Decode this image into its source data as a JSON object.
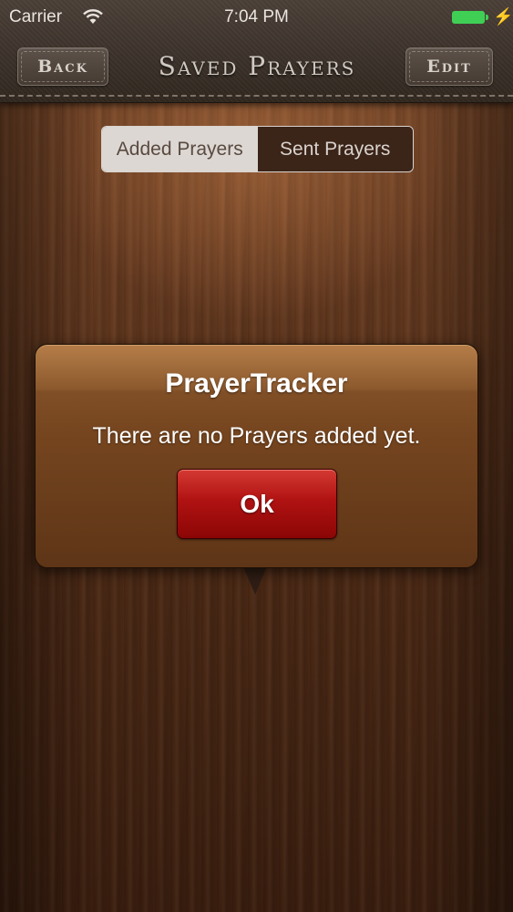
{
  "status_bar": {
    "carrier": "Carrier",
    "wifi_icon": "wifi-icon",
    "time": "7:04 PM",
    "battery_icon": "battery-icon",
    "charging_icon": "bolt-icon"
  },
  "nav": {
    "back_label": "Back",
    "title": "Saved Prayers",
    "edit_label": "Edit"
  },
  "segmented": {
    "items": [
      "Added Prayers",
      "Sent Prayers"
    ],
    "selected": "Added Prayers"
  },
  "alert": {
    "title": "PrayerTracker",
    "message": "There are no Prayers added yet.",
    "ok_label": "Ok"
  },
  "colors": {
    "alert_button": "#b01212",
    "battery": "#3fcf55",
    "wood": "#6a3d22"
  }
}
